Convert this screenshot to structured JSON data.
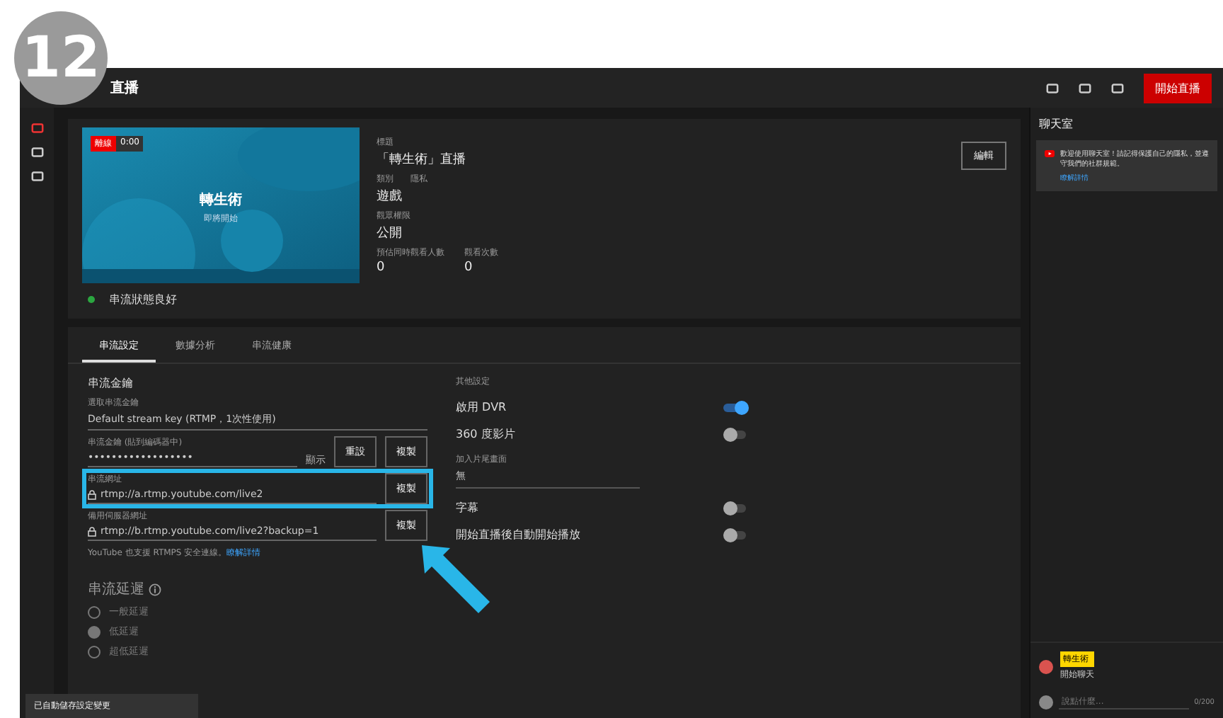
{
  "step_badge": "12",
  "app": {
    "title": "直播",
    "go_live": "開始直播"
  },
  "preview": {
    "badges": [
      "離線",
      "0:00"
    ],
    "title": "轉生術",
    "subtitle": "即將開始"
  },
  "details": [
    {
      "label": "標題",
      "value": "「轉生術」直播"
    },
    {
      "label": "類別　　隱私",
      "value": "遊戲"
    },
    {
      "label": "觀眾權限",
      "value": "公開"
    },
    {
      "label": "預估同時觀看人數",
      "value": "0",
      "label_2": "觀看次數",
      "value_2": "0"
    }
  ],
  "edit_button": "編輯",
  "stream_status": "串流狀態良好",
  "tabs": [
    {
      "label": "串流設定",
      "selected": true
    },
    {
      "label": "數據分析",
      "selected": false
    },
    {
      "label": "串流健康",
      "selected": false
    }
  ],
  "stream_key": {
    "heading": "串流金鑰",
    "select_label": "選取串流金鑰",
    "select_value": "Default stream key (RTMP，1次性使用)",
    "key_label": "串流金鑰 (貼到編碼器中)",
    "masked_key": "••••••••••••••••••",
    "show": "顯示",
    "reset": "重設",
    "copy": "複製"
  },
  "urls": [
    {
      "label": "串流網址",
      "value": "rtmp://a.rtmp.youtube.com/live2",
      "button": "複製",
      "highlighted": true
    },
    {
      "label": "備用伺服器網址",
      "value": "rtmp://b.rtmp.youtube.com/live2?backup=1",
      "button": "複製",
      "highlighted": false
    }
  ],
  "rtmps_note": "YouTube 也支援 RTMPS 安全連線。",
  "rtmps_link": "瞭解詳情",
  "latency": {
    "heading": "串流延遲",
    "options": [
      {
        "label": "一般延遲",
        "selected": false
      },
      {
        "label": "低延遲",
        "selected": true
      },
      {
        "label": "超低延遲",
        "selected": false
      }
    ]
  },
  "other": {
    "heading": "其他設定",
    "toggles": [
      {
        "label": "啟用 DVR",
        "on": true
      },
      {
        "label": "360 度影片",
        "on": false
      }
    ],
    "dropdown": {
      "label": "加入片尾畫面",
      "value": "無"
    },
    "toggles_2": [
      {
        "label": "字幕",
        "on": false
      },
      {
        "label": "開始直播後自動開始播放",
        "on": false
      }
    ]
  },
  "toast": "已自動儲存設定變更",
  "chat": {
    "title": "聊天室",
    "notice": "歡迎使用聊天室！請記得保護自己的隱私，並遵守我們的社群規範。",
    "notice_link": "瞭解詳情",
    "message": {
      "author": "轉生術",
      "text": "開始聊天"
    },
    "placeholder": "說點什麼...",
    "counter": "0/200"
  }
}
